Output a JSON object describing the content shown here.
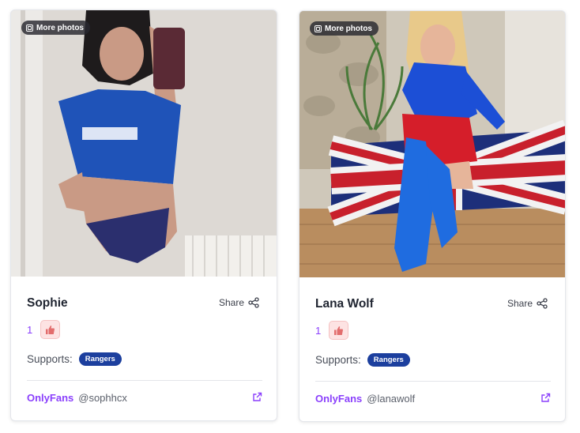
{
  "cards": [
    {
      "more_photos": "More photos",
      "name": "Sophie",
      "share": "Share",
      "likes": "1",
      "supports_label": "Supports:",
      "team": "Rangers",
      "site": "OnlyFans",
      "handle": "@sophhcx"
    },
    {
      "more_photos": "More photos",
      "name": "Lana Wolf",
      "share": "Share",
      "likes": "1",
      "supports_label": "Supports:",
      "team": "Rangers",
      "site": "OnlyFans",
      "handle": "@lanawolf"
    }
  ],
  "colors": {
    "accent": "#8a3ffc",
    "badge": "#1c3f9e",
    "like_bg": "#fde3e3",
    "like_icon": "#e26d6d"
  },
  "icons": [
    "gallery-icon",
    "share-icon",
    "thumbs-up-icon",
    "external-link-icon"
  ]
}
